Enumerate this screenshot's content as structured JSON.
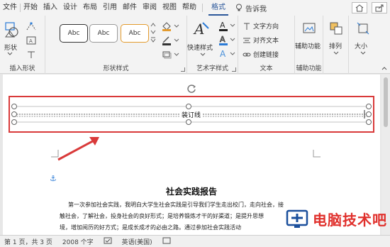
{
  "tabs": [
    "文件",
    "开始",
    "插入",
    "设计",
    "布局",
    "引用",
    "邮件",
    "审阅",
    "视图",
    "帮助",
    "格式"
  ],
  "active_tab": "格式",
  "tell_me": "告诉我",
  "ribbon": {
    "insert_shapes": {
      "shape_label": "形状",
      "group_label": "插入形状"
    },
    "shape_styles": {
      "style_sample": "Abc",
      "group_label": "形状样式"
    },
    "wordart": {
      "quick_styles_label": "快速样式",
      "group_label": "艺术字样式"
    },
    "text": {
      "direction": "文字方向",
      "align": "对齐文本",
      "link": "创建链接",
      "group_label": "文本"
    },
    "arrange": {
      "position_label": "辅助功能",
      "arrange_label": "排列",
      "group_label": "辅助功能"
    },
    "size": {
      "size_label": "大小"
    }
  },
  "document": {
    "line_text": "装订线",
    "title": "社会实践报告",
    "lines": [
      "第一次参加社会实践，我明白大学生社会实践是引导我们学生走出校门，走向社会，接",
      "触社会，了解社会，投身社会的良好形式；是培养锻炼才干的好渠道；是提升思想",
      "境，增加阅历的好方式；是成长成才的必由之路。通过参加社会实践活动"
    ]
  },
  "status": {
    "page": "第 1 页，共 3 页",
    "words": "2008 个字",
    "language": "英语(美国)"
  },
  "watermark": "电脑技术吧",
  "colors": {
    "accent": "#2b579a",
    "highlight": "#d93a3a",
    "arrow": "#d93a3a",
    "watermark": "#e0302c"
  }
}
